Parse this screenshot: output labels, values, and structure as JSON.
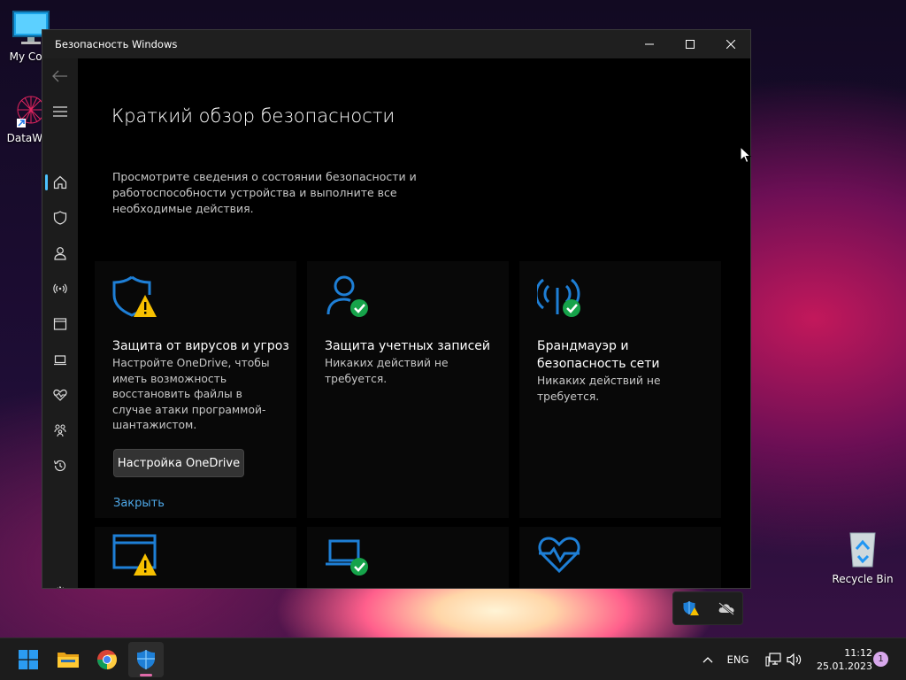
{
  "desktop": {
    "icons": [
      {
        "label": "My Com"
      },
      {
        "label": "DataWag"
      },
      {
        "label": "Recycle Bin"
      }
    ]
  },
  "window": {
    "title": "Безопасность Windows"
  },
  "sidebar": {
    "items": [
      "back-icon",
      "menu-icon",
      "home-icon",
      "shield-icon",
      "account-icon",
      "network-icon",
      "app-browser-icon",
      "device-icon",
      "health-icon",
      "family-icon",
      "history-icon",
      "settings-icon"
    ]
  },
  "main": {
    "title": "Краткий обзор безопасности",
    "description": "Просмотрите сведения о состоянии безопасности и работоспособности устройства и выполните все необходимые действия.",
    "cards": [
      {
        "title": "Защита от вирусов и угроз",
        "description": "Настройте OneDrive, чтобы иметь возможность восстановить файлы в случае атаки программой-шантажистом.",
        "button": "Настройка OneDrive",
        "link": "Закрыть",
        "status": "warning"
      },
      {
        "title": "Защита учетных записей",
        "description": "Никаких действий не требуется.",
        "status": "ok"
      },
      {
        "title": "Брандмауэр и безопасность сети",
        "description": "Никаких действий не требуется.",
        "status": "ok"
      }
    ]
  },
  "taskbar": {
    "apps": [
      "start-icon",
      "file-explorer-icon",
      "chrome-icon",
      "windows-security-icon"
    ],
    "language": "ENG",
    "time": "11:12",
    "date": "25.01.2023",
    "notifications": "1"
  },
  "colors": {
    "accent_blue": "#1e7fd6",
    "warning": "#f7c000",
    "ok": "#16a34a",
    "link": "#4ea8e8"
  }
}
